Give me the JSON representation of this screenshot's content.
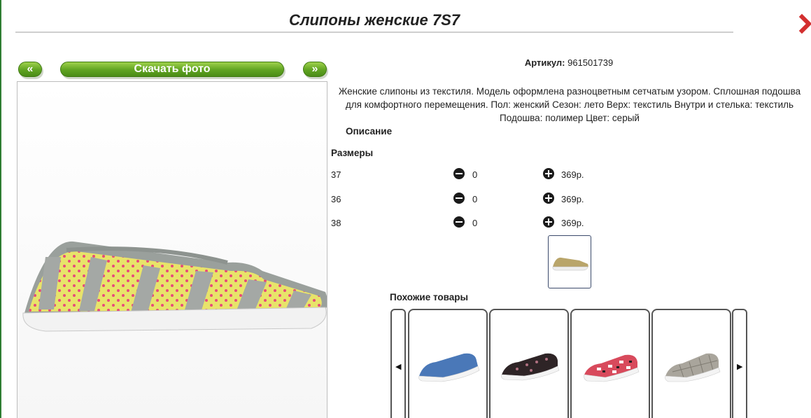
{
  "product": {
    "title": "Слипоны женские 7S7",
    "article_label": "Артикул:",
    "article_value": "961501739",
    "description": "Женские слипоны из текстиля. Модель оформлена разноцветным сетчатым узором. Сплошная подошва для комфортного перемещения.  Пол: женский Сезон: лето Верх: текстиль Внутри и стелька: текстиль Подошва: полимер Цвет: серый"
  },
  "buttons": {
    "prev": "«",
    "download": "Скачать фото",
    "next": "»"
  },
  "sections": {
    "description_label": "Описание",
    "sizes_label": "Размеры",
    "similar_label": "Похожие товары"
  },
  "sizes": [
    {
      "size": "37",
      "qty": "0",
      "price": "369р."
    },
    {
      "size": "36",
      "qty": "0",
      "price": "369р."
    },
    {
      "size": "38",
      "qty": "0",
      "price": "369р."
    }
  ],
  "icons": {
    "close": "close-x-icon",
    "minus": "minus-circle-icon",
    "plus": "plus-circle-icon",
    "carousel_prev": "skip-previous-icon",
    "carousel_next": "skip-next-icon"
  },
  "colors": {
    "accent_green": "#5fa321",
    "close_red": "#d32f2f"
  }
}
